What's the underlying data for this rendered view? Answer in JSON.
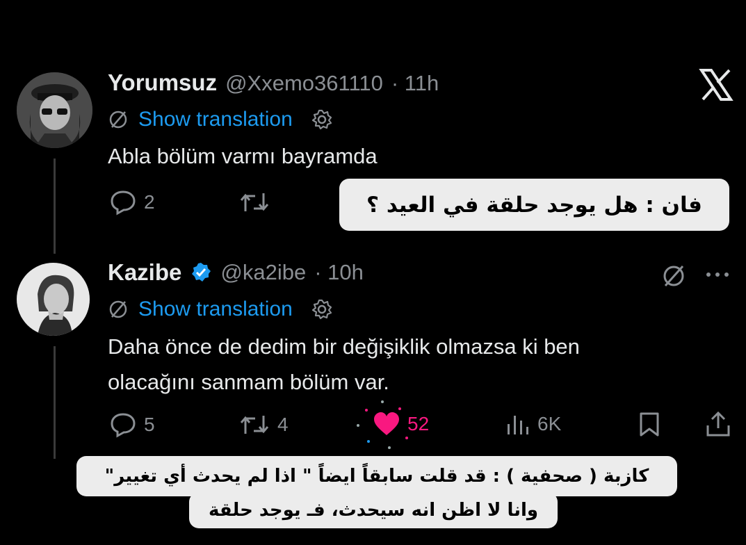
{
  "tweet1": {
    "name": "Yorumsuz",
    "handle": "@Xxemo361110",
    "time": "· 11h",
    "translate": "Show translation",
    "text": "Abla bölüm varmı bayramda",
    "replies": "2"
  },
  "caption1": "فان : هل يوجد حلقة في العيد ؟",
  "tweet2": {
    "name": "Kazibe",
    "handle": "@ka2ibe",
    "time": "· 10h",
    "translate": "Show translation",
    "text_line1": "Daha önce de dedim bir değişiklik olmazsa ki ben",
    "text_line2": "olacağını sanmam bölüm var.",
    "replies": "5",
    "reposts": "4",
    "likes": "52",
    "views": "6K"
  },
  "caption2": {
    "line1": "كازبة ( صحفية ) :  قد قلت سابقاً ايضاً \" اذا لم يحدث أي تغيير\"",
    "line2": "وانا لا اظن انه سيحدث، فـ يوجد حلقة"
  },
  "colors": {
    "link": "#1d9bf0",
    "like": "#f91880",
    "verified": "#1d9bf0",
    "muted": "#8b8f94"
  },
  "icons": [
    "x-logo-icon",
    "no-translate-icon",
    "gear-icon",
    "reply-icon",
    "repost-icon",
    "heart-icon",
    "views-icon",
    "bookmark-icon",
    "share-icon",
    "verified-icon",
    "more-icon"
  ]
}
